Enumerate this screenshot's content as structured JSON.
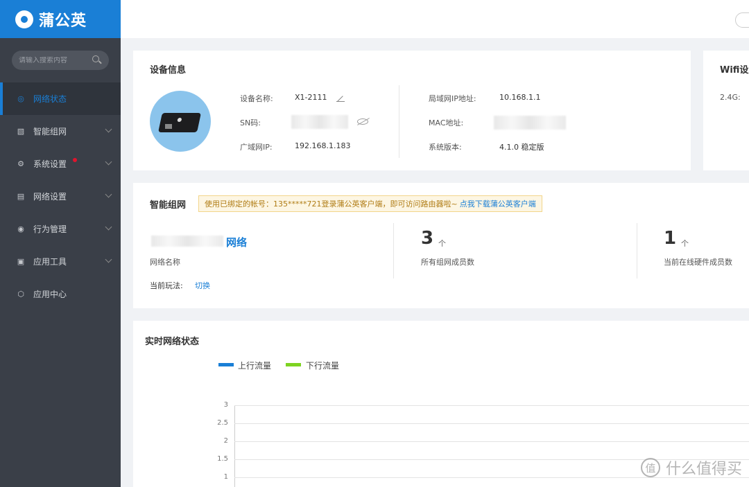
{
  "app": {
    "logo_text": "蒲公英"
  },
  "search": {
    "placeholder": "请输入搜索内容"
  },
  "sidebar": {
    "items": [
      {
        "label": "网络状态",
        "icon": "network-icon"
      },
      {
        "label": "智能组网",
        "icon": "mesh-icon"
      },
      {
        "label": "系统设置",
        "icon": "gear-icon"
      },
      {
        "label": "网络设置",
        "icon": "document-icon"
      },
      {
        "label": "行为管理",
        "icon": "target-icon"
      },
      {
        "label": "应用工具",
        "icon": "toolbox-icon"
      },
      {
        "label": "应用中心",
        "icon": "cube-icon"
      }
    ]
  },
  "device_info": {
    "title": "设备信息",
    "name_label": "设备名称:",
    "name_value": "X1-2111",
    "sn_label": "SN码:",
    "wan_ip_label": "广域网IP:",
    "wan_ip_value": "192.168.1.183",
    "lan_ip_label": "局域网IP地址:",
    "lan_ip_value": "10.168.1.1",
    "mac_label": "MAC地址:",
    "version_label": "系统版本:",
    "version_value": "4.1.0 稳定版"
  },
  "wifi": {
    "title": "Wifi设置",
    "band_label": "2.4G:"
  },
  "mesh": {
    "title": "智能组网",
    "notice_text": "使用已绑定的帐号：135*****721登录蒲公英客户端，即可访问路由器啦~",
    "notice_link": "点我下载蒲公英客户端",
    "network_name_suffix": "网络",
    "network_name_label": "网络名称",
    "mode_label": "当前玩法:",
    "mode_link": "切换",
    "members_count": "3",
    "members_unit": "个",
    "members_label": "所有组网成员数",
    "online_count": "1",
    "online_unit": "个",
    "online_label": "当前在线硬件成员数"
  },
  "realtime": {
    "title": "实时网络状态",
    "legend_up": "上行流量",
    "legend_down": "下行流量",
    "up_color": "#1a7fd6",
    "down_color": "#7ed321",
    "yticks": [
      "3",
      "2.5",
      "2",
      "1.5",
      "1"
    ]
  },
  "watermark": {
    "text": "什么值得买",
    "icon_text": "值"
  }
}
